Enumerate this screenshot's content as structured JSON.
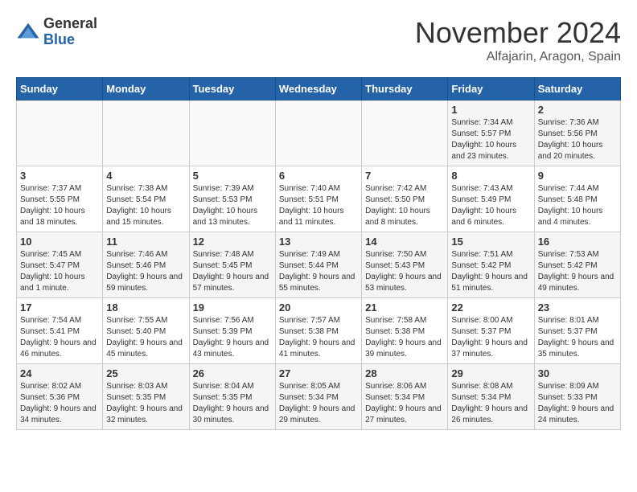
{
  "logo": {
    "general": "General",
    "blue": "Blue"
  },
  "title": "November 2024",
  "location": "Alfajarin, Aragon, Spain",
  "days_header": [
    "Sunday",
    "Monday",
    "Tuesday",
    "Wednesday",
    "Thursday",
    "Friday",
    "Saturday"
  ],
  "weeks": [
    [
      {
        "day": "",
        "info": ""
      },
      {
        "day": "",
        "info": ""
      },
      {
        "day": "",
        "info": ""
      },
      {
        "day": "",
        "info": ""
      },
      {
        "day": "",
        "info": ""
      },
      {
        "day": "1",
        "info": "Sunrise: 7:34 AM\nSunset: 5:57 PM\nDaylight: 10 hours and 23 minutes."
      },
      {
        "day": "2",
        "info": "Sunrise: 7:36 AM\nSunset: 5:56 PM\nDaylight: 10 hours and 20 minutes."
      }
    ],
    [
      {
        "day": "3",
        "info": "Sunrise: 7:37 AM\nSunset: 5:55 PM\nDaylight: 10 hours and 18 minutes."
      },
      {
        "day": "4",
        "info": "Sunrise: 7:38 AM\nSunset: 5:54 PM\nDaylight: 10 hours and 15 minutes."
      },
      {
        "day": "5",
        "info": "Sunrise: 7:39 AM\nSunset: 5:53 PM\nDaylight: 10 hours and 13 minutes."
      },
      {
        "day": "6",
        "info": "Sunrise: 7:40 AM\nSunset: 5:51 PM\nDaylight: 10 hours and 11 minutes."
      },
      {
        "day": "7",
        "info": "Sunrise: 7:42 AM\nSunset: 5:50 PM\nDaylight: 10 hours and 8 minutes."
      },
      {
        "day": "8",
        "info": "Sunrise: 7:43 AM\nSunset: 5:49 PM\nDaylight: 10 hours and 6 minutes."
      },
      {
        "day": "9",
        "info": "Sunrise: 7:44 AM\nSunset: 5:48 PM\nDaylight: 10 hours and 4 minutes."
      }
    ],
    [
      {
        "day": "10",
        "info": "Sunrise: 7:45 AM\nSunset: 5:47 PM\nDaylight: 10 hours and 1 minute."
      },
      {
        "day": "11",
        "info": "Sunrise: 7:46 AM\nSunset: 5:46 PM\nDaylight: 9 hours and 59 minutes."
      },
      {
        "day": "12",
        "info": "Sunrise: 7:48 AM\nSunset: 5:45 PM\nDaylight: 9 hours and 57 minutes."
      },
      {
        "day": "13",
        "info": "Sunrise: 7:49 AM\nSunset: 5:44 PM\nDaylight: 9 hours and 55 minutes."
      },
      {
        "day": "14",
        "info": "Sunrise: 7:50 AM\nSunset: 5:43 PM\nDaylight: 9 hours and 53 minutes."
      },
      {
        "day": "15",
        "info": "Sunrise: 7:51 AM\nSunset: 5:42 PM\nDaylight: 9 hours and 51 minutes."
      },
      {
        "day": "16",
        "info": "Sunrise: 7:53 AM\nSunset: 5:42 PM\nDaylight: 9 hours and 49 minutes."
      }
    ],
    [
      {
        "day": "17",
        "info": "Sunrise: 7:54 AM\nSunset: 5:41 PM\nDaylight: 9 hours and 46 minutes."
      },
      {
        "day": "18",
        "info": "Sunrise: 7:55 AM\nSunset: 5:40 PM\nDaylight: 9 hours and 45 minutes."
      },
      {
        "day": "19",
        "info": "Sunrise: 7:56 AM\nSunset: 5:39 PM\nDaylight: 9 hours and 43 minutes."
      },
      {
        "day": "20",
        "info": "Sunrise: 7:57 AM\nSunset: 5:38 PM\nDaylight: 9 hours and 41 minutes."
      },
      {
        "day": "21",
        "info": "Sunrise: 7:58 AM\nSunset: 5:38 PM\nDaylight: 9 hours and 39 minutes."
      },
      {
        "day": "22",
        "info": "Sunrise: 8:00 AM\nSunset: 5:37 PM\nDaylight: 9 hours and 37 minutes."
      },
      {
        "day": "23",
        "info": "Sunrise: 8:01 AM\nSunset: 5:37 PM\nDaylight: 9 hours and 35 minutes."
      }
    ],
    [
      {
        "day": "24",
        "info": "Sunrise: 8:02 AM\nSunset: 5:36 PM\nDaylight: 9 hours and 34 minutes."
      },
      {
        "day": "25",
        "info": "Sunrise: 8:03 AM\nSunset: 5:35 PM\nDaylight: 9 hours and 32 minutes."
      },
      {
        "day": "26",
        "info": "Sunrise: 8:04 AM\nSunset: 5:35 PM\nDaylight: 9 hours and 30 minutes."
      },
      {
        "day": "27",
        "info": "Sunrise: 8:05 AM\nSunset: 5:34 PM\nDaylight: 9 hours and 29 minutes."
      },
      {
        "day": "28",
        "info": "Sunrise: 8:06 AM\nSunset: 5:34 PM\nDaylight: 9 hours and 27 minutes."
      },
      {
        "day": "29",
        "info": "Sunrise: 8:08 AM\nSunset: 5:34 PM\nDaylight: 9 hours and 26 minutes."
      },
      {
        "day": "30",
        "info": "Sunrise: 8:09 AM\nSunset: 5:33 PM\nDaylight: 9 hours and 24 minutes."
      }
    ]
  ]
}
